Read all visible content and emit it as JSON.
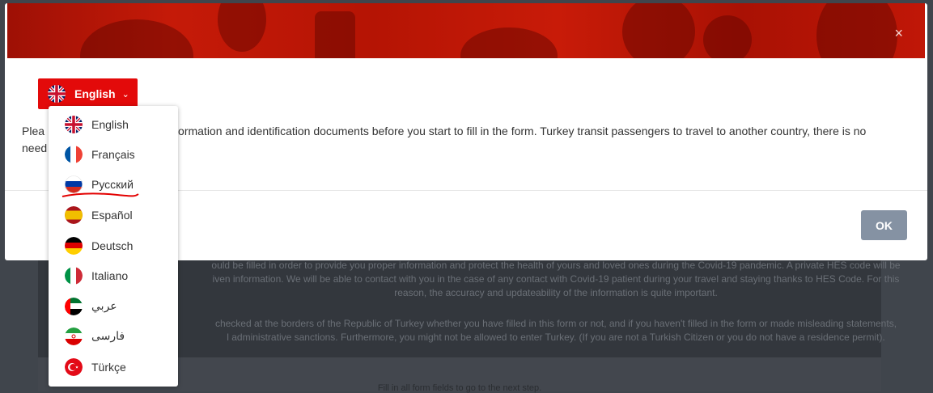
{
  "modal": {
    "close_label": "×",
    "language_button": {
      "label": "English",
      "chevron": "⌄"
    },
    "body_text_start": "Plea",
    "body_text_line1": "ormation and identification documents before you start to fill in the form. Turkey transit passengers to travel to another country, there is no",
    "body_text_line2": "need",
    "ok_label": "OK"
  },
  "languages": [
    {
      "label": "English",
      "flag": "uk-flag-icon"
    },
    {
      "label": "Français",
      "flag": "france-flag-icon"
    },
    {
      "label": "Русский",
      "flag": "russia-flag-icon"
    },
    {
      "label": "Español",
      "flag": "spain-flag-icon"
    },
    {
      "label": "Deutsch",
      "flag": "germany-flag-icon"
    },
    {
      "label": "Italiano",
      "flag": "italy-flag-icon"
    },
    {
      "label": "عربي",
      "flag": "uae-flag-icon"
    },
    {
      "label": "فارسی",
      "flag": "iran-flag-icon"
    },
    {
      "label": "Türkçe",
      "flag": "turkey-flag-icon"
    }
  ],
  "background": {
    "para1_line1": "ould be filled in order to provide you proper information and protect the health of yours and loved ones during the Covid-19 pandemic. A private HES code will be",
    "para1_line2": "iven information. We will be able to contact with you in the case of any contact with Covid-19 patient during your travel and staying thanks to HES Code. For this",
    "para1_line3": "reason, the accuracy and updateability of the information is quite important.",
    "para2_line1": "checked at the borders of the Republic of Turkey whether you have filled in this form or not, and if you haven't filled in the form or made misleading statements,",
    "para2_line2": "l administrative sanctions. Furthermore, you might not be allowed to enter Turkey. (If you are not a Turkish Citizen or you do not have a residence permit).",
    "footer_text": "Fill in all form fields to go to the next step."
  },
  "colors": {
    "accent_red": "#e30a0a",
    "ok_button": "#8592a3",
    "selection_underline": "#e30000"
  }
}
